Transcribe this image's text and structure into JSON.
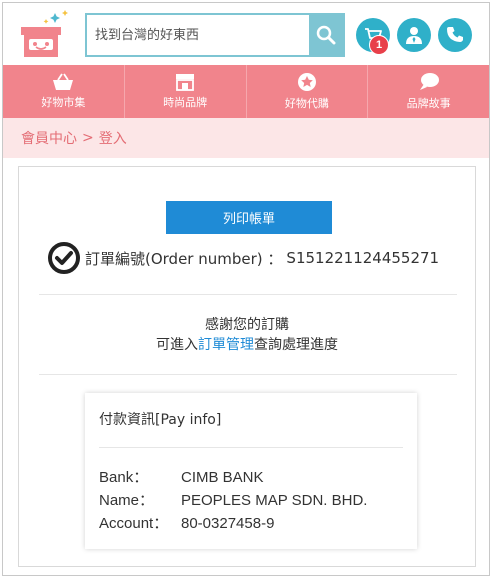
{
  "header": {
    "logo_icon": "gift-box-logo-icon",
    "search": {
      "placeholder": "找到台灣的好東西",
      "value": ""
    },
    "search_icon": "search-icon",
    "cart_count": "1",
    "cart_icon": "cart-icon",
    "member_icon": "user-icon",
    "phone_icon": "phone-icon"
  },
  "nav": {
    "items": [
      {
        "label": "好物市集",
        "icon": "shopping-basket-icon"
      },
      {
        "label": "時尚品牌",
        "icon": "storefront-icon"
      },
      {
        "label": "好物代購",
        "icon": "star-badge-icon"
      },
      {
        "label": "品牌故事",
        "icon": "chat-bubble-icon"
      }
    ]
  },
  "breadcrumb": {
    "parent": "會員中心",
    "separator": ">",
    "current": "登入"
  },
  "order": {
    "print_label": "列印帳單",
    "check_icon": "check-circle-icon",
    "number_label": "訂單編號(Order number) ：",
    "number_value": "S151221124455271"
  },
  "thanks": {
    "line1": "感謝您的訂購",
    "line2_prefix": "可進入",
    "line2_link": "訂單管理",
    "line2_suffix": "查詢處理進度"
  },
  "payment": {
    "title": "付款資訊[Pay info]",
    "bank_label": "Bank：",
    "bank_value": "CIMB BANK",
    "name_label": "Name：",
    "name_value": "PEOPLES MAP SDN. BHD.",
    "account_label": "Account：",
    "account_value": "80-0327458-9"
  },
  "colors": {
    "brand_pink": "#f1848c",
    "teal": "#2fb0c9",
    "link_blue": "#1f8bd6",
    "breadcrumb_bg": "#fce6e7"
  }
}
